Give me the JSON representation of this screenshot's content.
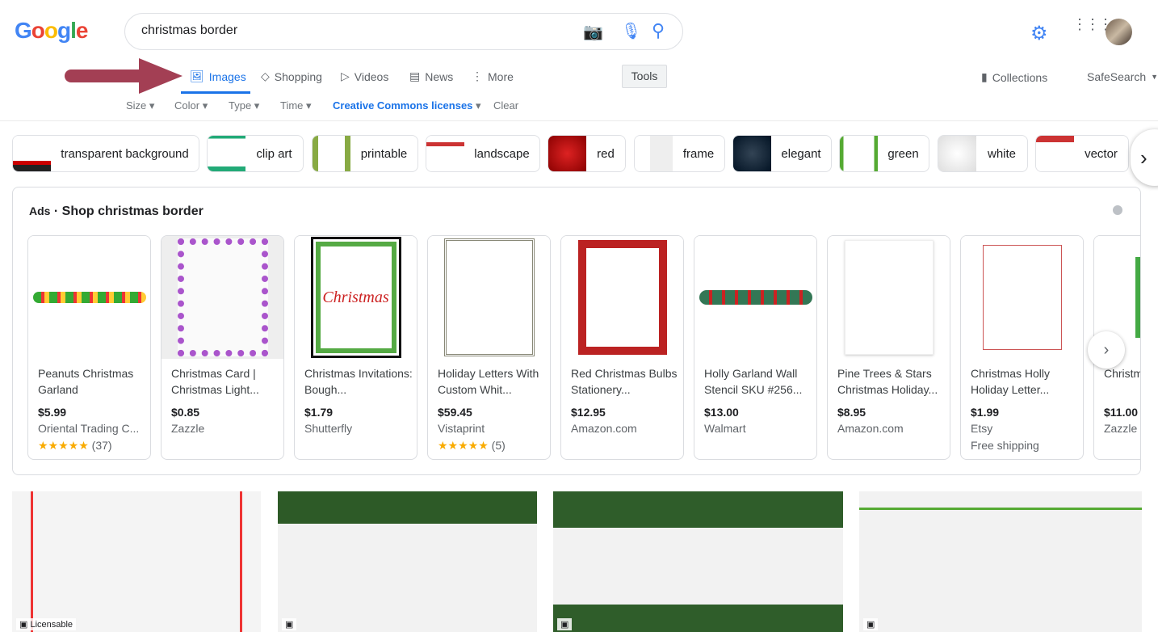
{
  "header": {
    "logo": "Google",
    "query": "christmas border",
    "icons": [
      "camera-icon",
      "microphone-icon",
      "search-icon",
      "gear-icon",
      "apps-icon",
      "avatar"
    ]
  },
  "tabs": [
    {
      "label": "Images",
      "icon": "image-icon",
      "active": true
    },
    {
      "label": "Shopping",
      "icon": "tag-icon"
    },
    {
      "label": "Videos",
      "icon": "play-icon"
    },
    {
      "label": "News",
      "icon": "news-icon"
    },
    {
      "label": "More",
      "icon": "more-vert-icon"
    }
  ],
  "tools": "Tools",
  "collections": "Collections",
  "safesearch": "SafeSearch",
  "filters": [
    "Size",
    "Color",
    "Type",
    "Time",
    "Creative Commons licenses",
    "Clear"
  ],
  "chips": [
    "transparent background",
    "clip art",
    "printable",
    "landscape",
    "red",
    "frame",
    "elegant",
    "green",
    "white",
    "vector"
  ],
  "ads": {
    "label": "Ads",
    "title": "Shop christmas border",
    "products": [
      {
        "title": "Peanuts Christmas Garland",
        "price": "$5.99",
        "store": "Oriental Trading C...",
        "rating": "★★★★★",
        "reviews": "(37)"
      },
      {
        "title": "Christmas Card | Christmas Light...",
        "price": "$0.85",
        "store": "Zazzle"
      },
      {
        "title": "Christmas Invitations: Bough...",
        "price": "$1.79",
        "store": "Shutterfly"
      },
      {
        "title": "Holiday Letters With Custom Whit...",
        "price": "$59.45",
        "store": "Vistaprint",
        "rating": "★★★★★",
        "reviews": "(5)"
      },
      {
        "title": "Red Christmas Bulbs Stationery...",
        "price": "$12.95",
        "store": "Amazon.com"
      },
      {
        "title": "Holly Garland Wall Stencil SKU #256...",
        "price": "$13.00",
        "store": "Walmart"
      },
      {
        "title": "Pine Trees & Stars Christmas Holiday...",
        "price": "$8.95",
        "store": "Amazon.com"
      },
      {
        "title": "Christmas Holly Holiday Letter...",
        "price": "$1.99",
        "store": "Etsy",
        "extra": "Free shipping"
      },
      {
        "title": "Christmas Border",
        "price": "$11.00",
        "store": "Zazzle"
      }
    ]
  },
  "results": [
    {
      "badge": "Licensable"
    },
    {},
    {},
    {}
  ],
  "colors": {
    "accent": "#1a73e8",
    "arrow": "#a33f54"
  }
}
